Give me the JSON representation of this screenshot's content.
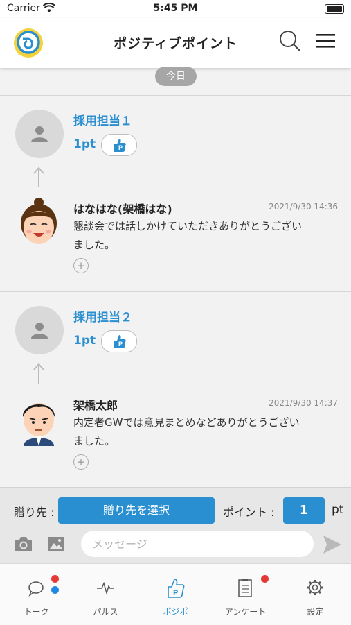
{
  "status_bar": {
    "carrier": "Carrier",
    "time": "5:45 PM"
  },
  "header": {
    "title": "ポジティブポイント",
    "logo_icon": "app-logo-icon",
    "search_icon": "search-icon",
    "menu_icon": "hamburger-menu-icon"
  },
  "date_chip": "今日",
  "feed": [
    {
      "recipient": "採用担当１",
      "points": "1pt",
      "sender": "はなはな(架橋はな)",
      "timestamp": "2021/9/30 14:36",
      "message_lines": [
        "懇談会では話しかけていただきありがとうござい",
        "ました。"
      ]
    },
    {
      "recipient": "採用担当２",
      "points": "1pt",
      "sender": "架橋太郎",
      "timestamp": "2021/9/30 14:37",
      "message_lines": [
        "内定者GWでは意見まとめなどありがとうござい",
        "ました。"
      ]
    }
  ],
  "compose": {
    "to_label": "贈り先 :",
    "select_button": "贈り先を選択",
    "points_label": "ポイント :",
    "points_value": "1",
    "points_unit": "pt",
    "message_placeholder": "メッセージ"
  },
  "tabs": [
    {
      "label": "トーク",
      "icon": "chat-bubble-icon",
      "badges": [
        "#e53935",
        "#1e88e5"
      ]
    },
    {
      "label": "パルス",
      "icon": "pulse-icon",
      "badges": []
    },
    {
      "label": "ポジポ",
      "icon": "thumbs-up-p-icon",
      "active": true,
      "badges": []
    },
    {
      "label": "アンケート",
      "icon": "clipboard-icon",
      "badges": [
        "#e53935"
      ]
    },
    {
      "label": "設定",
      "icon": "gear-icon",
      "badges": []
    }
  ],
  "colors": {
    "accent": "#2a8fd0",
    "badge_red": "#e53935",
    "badge_blue": "#1e88e5"
  }
}
